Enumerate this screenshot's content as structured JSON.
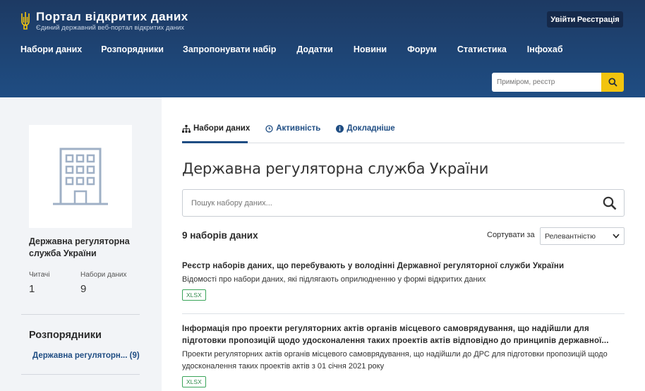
{
  "header": {
    "title": "Портал відкритих даних",
    "subtitle": "Єдиний державний веб-портал відкритих даних",
    "login": "Увійти",
    "register": "Реєстрація",
    "nav": [
      "Набори даних",
      "Розпорядники",
      "Запропонувати набір",
      "Додатки",
      "Новини",
      "Форум",
      "Статистика",
      "Інфохаб"
    ],
    "search_placeholder": "Приміром, реєстр",
    "accent": "#f2c40f",
    "bg": "#1f4d83"
  },
  "sidebar": {
    "org_name": "Державна регуляторна служба України",
    "followers_label": "Читачі",
    "followers_value": "1",
    "datasets_label": "Набори даних",
    "datasets_value": "9",
    "section_title": "Розпорядники",
    "link": "Державна регуляторн... (9)"
  },
  "main": {
    "tabs": [
      {
        "label": "Набори даних",
        "icon": "sitemap-icon"
      },
      {
        "label": "Активність",
        "icon": "clock-icon"
      },
      {
        "label": "Докладніше",
        "icon": "info-icon"
      }
    ],
    "title": "Державна регуляторна служба України",
    "search_placeholder": "Пошук набору даних...",
    "count": "9 наборів даних",
    "sort_label": "Сортувати за",
    "sort_value": "Релевантністю",
    "items": [
      {
        "title": "Реєстр наборів даних, що перебувають у володінні Державної регуляторної служби України",
        "desc": "Відомості про набори даних, які підлягають оприлюдненню у формі відкритих даних",
        "format": "XLSX"
      },
      {
        "title": "Інформація про проекти регуляторних актів органів місцевого самоврядування, що надійшли для підготовки пропозицій щодо удосконалення таких проектів актів відповідно до принципів державної...",
        "desc": "Проекти регуляторних актів органів місцевого самоврядування, що надійшли до ДРС для підготовки пропозицій щодо удосконалення таких проектів актів з 01 січня 2021 року",
        "format": "XLSX"
      }
    ]
  }
}
